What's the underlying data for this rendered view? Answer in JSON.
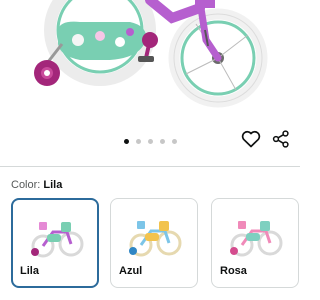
{
  "product": {
    "image_alt": "Kids bike with training wheels",
    "carousel": {
      "total": 5,
      "active_index": 0
    },
    "actions": {
      "favorite_icon": "heart-outline-icon",
      "share_icon": "share-icon"
    },
    "color_selector": {
      "label": "Color:",
      "selected_value": "Lila",
      "options": [
        {
          "label": "Lila",
          "selected": true
        },
        {
          "label": "Azul",
          "selected": false
        },
        {
          "label": "Rosa",
          "selected": false
        }
      ]
    }
  },
  "colors": {
    "frame_purple": "#b65fcf",
    "tire_white": "#f2f2f2",
    "mint": "#79cfb2",
    "magenta_wheel": "#a3267a",
    "selected_border": "#2c6b9b",
    "divider": "#d5d9d9"
  }
}
